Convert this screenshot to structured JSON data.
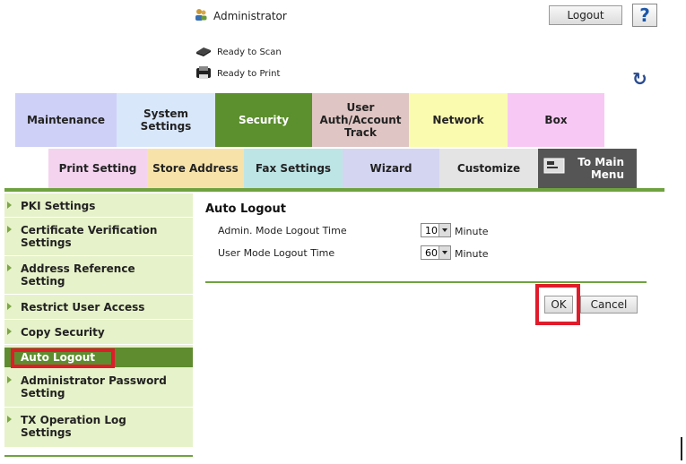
{
  "header": {
    "user_label": "Administrator",
    "logout_label": "Logout",
    "help_symbol": "?",
    "status_scan": "Ready to Scan",
    "status_print": "Ready to Print"
  },
  "tabs_top": [
    {
      "label": "Maintenance",
      "color": "#cfd0f7"
    },
    {
      "label": "System\nSettings",
      "color": "#d9e7fb"
    },
    {
      "label": "Security",
      "color": "#5c8f2d",
      "active": true
    },
    {
      "label": "User\nAuth/Account\nTrack",
      "color": "#dfc5c3"
    },
    {
      "label": "Network",
      "color": "#fbfbb0"
    },
    {
      "label": "Box",
      "color": "#f8c8f4"
    }
  ],
  "tabs_sub": [
    {
      "label": "Print Setting",
      "color": "#f4d3ef"
    },
    {
      "label": "Store Address",
      "color": "#f7e3a9"
    },
    {
      "label": "Fax Settings",
      "color": "#bde5e6"
    },
    {
      "label": "Wizard",
      "color": "#d4d5f1"
    },
    {
      "label": "Customize",
      "color": "#e4e4e4"
    },
    {
      "label": "To Main\nMenu",
      "color": "#555555"
    }
  ],
  "sidebar": {
    "items": [
      {
        "label": "PKI Settings"
      },
      {
        "label": "Certificate Verification Settings"
      },
      {
        "label": "Address Reference Setting"
      },
      {
        "label": "Restrict User Access"
      },
      {
        "label": "Copy Security"
      },
      {
        "label": "Auto Logout",
        "active": true
      },
      {
        "label": "Administrator Password Setting"
      },
      {
        "label": "TX Operation Log Settings"
      }
    ]
  },
  "main": {
    "title": "Auto Logout",
    "admin_label": "Admin. Mode Logout Time",
    "admin_value": "10",
    "user_label": "User Mode Logout Time",
    "user_value": "60",
    "unit": "Minute",
    "ok_label": "OK",
    "cancel_label": "Cancel"
  },
  "colors": {
    "accent_green": "#6fa23f",
    "highlight_red": "#e01c2b"
  }
}
